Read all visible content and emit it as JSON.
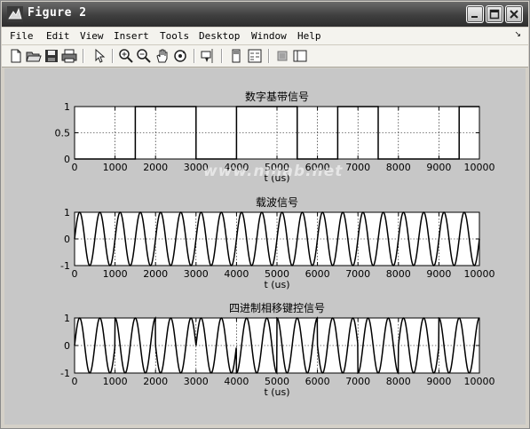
{
  "window": {
    "title": "Figure 2",
    "controls": [
      "minimize",
      "maximize",
      "close"
    ]
  },
  "menu": {
    "items": [
      "File",
      "Edit",
      "View",
      "Insert",
      "Tools",
      "Desktop",
      "Window",
      "Help"
    ],
    "overflow_arrow": "↘"
  },
  "toolbar": {
    "icons": [
      "new-file-icon",
      "open-folder-icon",
      "save-icon",
      "print-icon",
      "pointer-icon",
      "zoom-in-icon",
      "zoom-out-icon",
      "pan-hand-icon",
      "rotate-3d-icon",
      "data-cursor-icon",
      "colorbar-icon",
      "legend-icon",
      "plot-tools-hide-icon",
      "plot-tools-show-icon"
    ]
  },
  "watermark": "www.ninab.net",
  "colors": {
    "figure_bg": "#c7c7c7",
    "axes_bg": "#ffffff",
    "line": "#000000"
  },
  "chart_data": [
    {
      "type": "line",
      "title": "数字基带信号",
      "xlabel": "t (us)",
      "xlim": [
        0,
        10000
      ],
      "ylim": [
        0,
        1
      ],
      "xticks": [
        0,
        1000,
        2000,
        3000,
        4000,
        5000,
        6000,
        7000,
        8000,
        9000,
        10000
      ],
      "yticks": [
        0,
        0.5,
        1
      ],
      "ytick_labels": [
        "0",
        "0.5",
        "1"
      ],
      "grid": true,
      "series": [
        {
          "style": "step",
          "x": [
            0,
            1500,
            1500,
            3000,
            3000,
            4000,
            4000,
            5500,
            5500,
            6500,
            6500,
            7500,
            7500,
            9500,
            9500,
            10000
          ],
          "y": [
            0,
            0,
            1,
            1,
            0,
            0,
            1,
            1,
            0,
            0,
            1,
            1,
            0,
            0,
            1,
            1
          ]
        }
      ]
    },
    {
      "type": "line",
      "title": "载波信号",
      "xlabel": "t (us)",
      "xlim": [
        0,
        10000
      ],
      "ylim": [
        -1,
        1
      ],
      "xticks": [
        0,
        1000,
        2000,
        3000,
        4000,
        5000,
        6000,
        7000,
        8000,
        9000,
        10000
      ],
      "yticks": [
        -1,
        0,
        1
      ],
      "ytick_labels": [
        "-1",
        "0",
        "1"
      ],
      "grid": true,
      "series": [
        {
          "style": "sine",
          "frequency_cycles": 20,
          "amplitude": 1,
          "phase_shifts": []
        }
      ]
    },
    {
      "type": "line",
      "title": "四进制相移键控信号",
      "xlabel": "t (us)",
      "xlim": [
        0,
        10000
      ],
      "ylim": [
        -1,
        1
      ],
      "xticks": [
        0,
        1000,
        2000,
        3000,
        4000,
        5000,
        6000,
        7000,
        8000,
        9000,
        10000
      ],
      "yticks": [
        -1,
        0,
        1
      ],
      "ytick_labels": [
        "-1",
        "0",
        "1"
      ],
      "grid": true,
      "series": [
        {
          "style": "sine",
          "frequency_cycles": 20,
          "amplitude": 1,
          "phase_shifts": [
            {
              "t": 0,
              "phase": 0
            },
            {
              "t": 1000,
              "phase": 1.5708
            },
            {
              "t": 2000,
              "phase": 3.1416
            },
            {
              "t": 3000,
              "phase": 0
            },
            {
              "t": 4000,
              "phase": 4.7124
            },
            {
              "t": 5000,
              "phase": 1.5708
            },
            {
              "t": 6000,
              "phase": 3.1416
            },
            {
              "t": 7000,
              "phase": 4.7124
            },
            {
              "t": 8000,
              "phase": 0
            },
            {
              "t": 9000,
              "phase": 1.5708
            }
          ]
        }
      ]
    }
  ]
}
